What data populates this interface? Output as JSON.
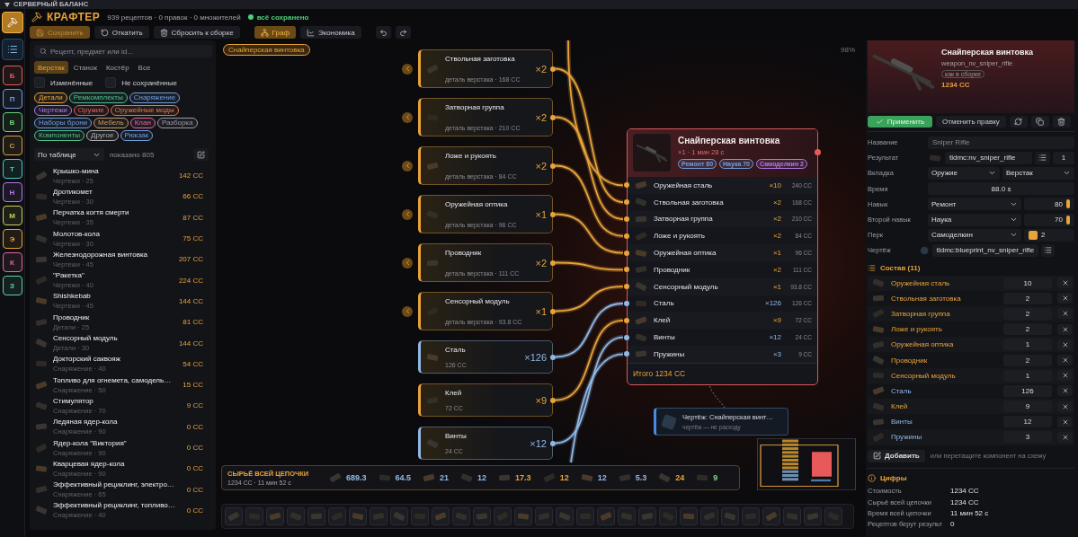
{
  "top_strip": {
    "title": "СЕРВЕРНЫЙ БАЛАНС"
  },
  "rail": {
    "tools": [
      {
        "kind": "crafter",
        "selected": true
      },
      {
        "kind": "list",
        "selected": false
      }
    ],
    "letters": [
      {
        "label": "Б",
        "color": "#e0605a"
      },
      {
        "label": "П",
        "color": "#6f9fe0"
      },
      {
        "label": "В",
        "color": "#6fcf7a"
      },
      {
        "label": "С",
        "color": "#d4a04a"
      },
      {
        "label": "Т",
        "color": "#4fc6c0"
      },
      {
        "label": "Н",
        "color": "#b07ae8"
      },
      {
        "label": "М",
        "color": "#c8d05a"
      },
      {
        "label": "Э",
        "color": "#e8a33a"
      },
      {
        "label": "К",
        "color": "#e06aa0"
      },
      {
        "label": "З",
        "color": "#5fd0a8"
      }
    ]
  },
  "header": {
    "title": "КРАФТЕР",
    "stats": "939 рецептов · 0 правок · 0 множителей",
    "status": "всё сохранено"
  },
  "toolbar": {
    "actions": [
      {
        "kind": "save",
        "label": "Сохранить"
      },
      {
        "kind": "revert",
        "label": "Откатить"
      },
      {
        "kind": "reset",
        "label": "Сбросить к сборке"
      }
    ],
    "views": [
      {
        "kind": "graph",
        "label": "Граф",
        "selected": true
      },
      {
        "kind": "economy",
        "label": "Экономика",
        "selected": false
      }
    ],
    "history": [
      {
        "kind": "undo"
      },
      {
        "kind": "redo"
      }
    ]
  },
  "sidebar": {
    "search": {
      "placeholder": "Рецепт, предмет или id..."
    },
    "tabs": [
      {
        "label": "Верстак",
        "selected": true
      },
      {
        "label": "Станок",
        "selected": false
      },
      {
        "label": "Костёр",
        "selected": false
      },
      {
        "label": "Все",
        "selected": false
      }
    ],
    "toggles": [
      {
        "label": "Изменённые",
        "checked": false
      },
      {
        "label": "Не сохранённые",
        "checked": false
      }
    ],
    "chips": [
      {
        "label": "Детали",
        "color": "#e8a33a"
      },
      {
        "label": "Ремкомплекты",
        "color": "#4fc08f"
      },
      {
        "label": "Снаряжение",
        "color": "#6f9fe0"
      },
      {
        "label": "Чертежи",
        "color": "#b07ae8"
      },
      {
        "label": "Оружие",
        "color": "#e0605a"
      },
      {
        "label": "Оружейные моды",
        "color": "#e07a4a"
      },
      {
        "label": "Наборы брони",
        "color": "#6f9fe0"
      },
      {
        "label": "Мебель",
        "color": "#c89a6a"
      },
      {
        "label": "Клан",
        "color": "#e06aa0"
      },
      {
        "label": "Разборка",
        "color": "#9a9aa0"
      },
      {
        "label": "Компоненты",
        "color": "#4fc08f"
      },
      {
        "label": "Другое",
        "color": "#b0b0b5"
      },
      {
        "label": "Рюкзак",
        "color": "#6f9fe0"
      }
    ],
    "sort": {
      "value": "По таблице"
    },
    "shown": "показано 805",
    "items": [
      {
        "name": "Крышко-мина",
        "meta": "Чертежи · 25",
        "cost": "142 CC"
      },
      {
        "name": "Дротикомет",
        "meta": "Чертежи · 30",
        "cost": "66 CC"
      },
      {
        "name": "Перчатка когтя смерти",
        "meta": "Чертежи · 35",
        "cost": "87 CC"
      },
      {
        "name": "Молотов-кола",
        "meta": "Чертежи · 30",
        "cost": "75 CC"
      },
      {
        "name": "Железнодорожная винтовка",
        "meta": "Чертежи · 45",
        "cost": "207 CC"
      },
      {
        "name": "\"Ракетка\"",
        "meta": "Чертежи · 40",
        "cost": "224 CC"
      },
      {
        "name": "Shishkebab",
        "meta": "Чертежи · 45",
        "cost": "144 CC"
      },
      {
        "name": "Проводник",
        "meta": "Детали · 25",
        "cost": "81 CC"
      },
      {
        "name": "Сенсорный модуль",
        "meta": "Детали · 30",
        "cost": "144 CC"
      },
      {
        "name": "Докторский саквояж",
        "meta": "Снаряжение · 40",
        "cost": "54 CC"
      },
      {
        "name": "Топливо для огнемета, самодель…",
        "meta": "Снаряжение · 50",
        "cost": "15 CC"
      },
      {
        "name": "Стимулятор",
        "meta": "Снаряжение · 70",
        "cost": "9 CC"
      },
      {
        "name": "Ледяная ядер-кола",
        "meta": "Снаряжение · 90",
        "cost": "0 CC"
      },
      {
        "name": "Ядер-кола \"Виктория\"",
        "meta": "Снаряжение · 90",
        "cost": "0 CC"
      },
      {
        "name": "Кварцевая ядер-кола",
        "meta": "Снаряжение · 90",
        "cost": "0 CC"
      },
      {
        "name": "Эффективный рециклинг, электро…",
        "meta": "Снаряжение · 65",
        "cost": "0 CC"
      },
      {
        "name": "Эффективный рециклинг, топливо…",
        "meta": "Снаряжение · 40",
        "cost": "0 CC"
      }
    ]
  },
  "canvas": {
    "breadcrumb": "Снайперская винтовка",
    "zoom": "98%",
    "sources": [
      {
        "kind": "part",
        "name": "Ствольная заготовка",
        "subtitle": "деталь верстака · 168 CC",
        "qty": "×2"
      },
      {
        "kind": "part",
        "name": "Затворная группа",
        "subtitle": "деталь верстака · 210 CC",
        "qty": "×2"
      },
      {
        "kind": "part",
        "name": "Ложе и рукоять",
        "subtitle": "деталь верстака · 84 CC",
        "qty": "×2"
      },
      {
        "kind": "part",
        "name": "Оружейная оптика",
        "subtitle": "деталь верстака · 96 CC",
        "qty": "×1"
      },
      {
        "kind": "part",
        "name": "Проводник",
        "subtitle": "деталь верстака · 111 CC",
        "qty": "×2"
      },
      {
        "kind": "part",
        "name": "Сенсорный модуль",
        "subtitle": "деталь верстака · 93.8 CC",
        "qty": "×1"
      },
      {
        "kind": "resource",
        "name": "Сталь",
        "subtitle": "126 CC",
        "qty": "×126"
      },
      {
        "kind": "crafted",
        "name": "Клей",
        "subtitle": "72 CC",
        "qty": "×9"
      },
      {
        "kind": "resource",
        "name": "Винты",
        "subtitle": "24 CC",
        "qty": "×12"
      }
    ],
    "target": {
      "title": "Снайперская винтовка",
      "meta": "×1 · 1 мин 28 с",
      "badges": [
        {
          "label": "Ремонт 80",
          "color": "#6f9fe0"
        },
        {
          "label": "Наука 70",
          "color": "#6f9fe0"
        },
        {
          "label": "Самоделкин 2",
          "color": "#b07ae8"
        }
      ],
      "rows": [
        {
          "kind": "part",
          "name": "Оружейная сталь",
          "qty": "×10",
          "cost": "240 CC"
        },
        {
          "kind": "part",
          "name": "Ствольная заготовка",
          "qty": "×2",
          "cost": "168 CC"
        },
        {
          "kind": "part",
          "name": "Затворная группа",
          "qty": "×2",
          "cost": "210 CC"
        },
        {
          "kind": "part",
          "name": "Ложе и рукоять",
          "qty": "×2",
          "cost": "84 CC"
        },
        {
          "kind": "part",
          "name": "Оружейная оптика",
          "qty": "×1",
          "cost": "96 CC"
        },
        {
          "kind": "part",
          "name": "Проводник",
          "qty": "×2",
          "cost": "111 CC"
        },
        {
          "kind": "part",
          "name": "Сенсорный модуль",
          "qty": "×1",
          "cost": "93.8 CC"
        },
        {
          "kind": "resource",
          "name": "Сталь",
          "qty": "×126",
          "cost": "126 CC"
        },
        {
          "kind": "crafted",
          "name": "Клей",
          "qty": "×9",
          "cost": "72 CC"
        },
        {
          "kind": "resource",
          "name": "Винты",
          "qty": "×12",
          "cost": "24 CC"
        },
        {
          "kind": "resource",
          "name": "Пружины",
          "qty": "×3",
          "cost": "9 CC"
        }
      ],
      "total": "Итого 1234 CC"
    },
    "blueprint": {
      "title": "Чертёж: Снайперская винт…",
      "subtitle": "чертёж — не расходу"
    },
    "summary": {
      "title": "СЫРЬЁ ВСЕЙ ЦЕПОЧКИ",
      "subtitle": "1234 CC · 11 мин 52 с",
      "items": [
        {
          "value": "689.3",
          "color": "#8fb8e6"
        },
        {
          "value": "64.5",
          "color": "#8fb8e6"
        },
        {
          "value": "21",
          "color": "#8fb8e6"
        },
        {
          "value": "12",
          "color": "#8fb8e6"
        },
        {
          "value": "17.3",
          "color": "#e8a33a"
        },
        {
          "value": "12",
          "color": "#e8a33a"
        },
        {
          "value": "12",
          "color": "#8fb8e6"
        },
        {
          "value": "5.3",
          "color": "#8fb8e6"
        },
        {
          "value": "24",
          "color": "#e8a33a"
        },
        {
          "value": "9",
          "color": "#7fd18b"
        }
      ]
    }
  },
  "inspector": {
    "preview": {
      "title": "Снайперская винтовка",
      "id": "weapon_nv_sniper_rifle",
      "badge": "как в сборке",
      "cost": "1234 CC"
    },
    "actions": [
      {
        "kind": "apply",
        "label": "Применить"
      },
      {
        "kind": "revert",
        "label": "Отменить правку"
      },
      {
        "kind": "refresh"
      },
      {
        "kind": "copy"
      },
      {
        "kind": "delete"
      }
    ],
    "fields": [
      {
        "kind": "text",
        "label": "Название",
        "placeholder": "Sniper Rifle"
      },
      {
        "kind": "result",
        "label": "Результат",
        "value": "tldmc:nv_sniper_rifle",
        "count": "1"
      },
      {
        "kind": "selects",
        "label": "Вкладка",
        "values": [
          "Оружие",
          "Верстак"
        ]
      },
      {
        "kind": "time",
        "label": "Время",
        "value": "88.0 s"
      },
      {
        "kind": "skill",
        "label": "Навык",
        "value": "Ремонт",
        "amount": "80"
      },
      {
        "kind": "skill",
        "label": "Второй навык",
        "value": "Наука",
        "amount": "70"
      },
      {
        "kind": "perk",
        "label": "Перк",
        "value": "Самоделкин",
        "amount": "2"
      },
      {
        "kind": "blueprint",
        "label": "Чертёж",
        "value": "tldmc:blueprint_nv_sniper_rifle"
      }
    ],
    "composition_title": "Состав (11)",
    "composition": [
      {
        "kind": "part",
        "name": "Оружейная сталь",
        "amount": "10"
      },
      {
        "kind": "part",
        "name": "Ствольная заготовка",
        "amount": "2"
      },
      {
        "kind": "part",
        "name": "Затворная группа",
        "amount": "2"
      },
      {
        "kind": "part",
        "name": "Ложе и рукоять",
        "amount": "2"
      },
      {
        "kind": "part",
        "name": "Оружейная оптика",
        "amount": "1"
      },
      {
        "kind": "part",
        "name": "Проводник",
        "amount": "2"
      },
      {
        "kind": "part",
        "name": "Сенсорный модуль",
        "amount": "1"
      },
      {
        "kind": "resource",
        "name": "Сталь",
        "amount": "126"
      },
      {
        "kind": "crafted",
        "name": "Клей",
        "amount": "9"
      },
      {
        "kind": "resource",
        "name": "Винты",
        "amount": "12"
      },
      {
        "kind": "resource",
        "name": "Пружины",
        "amount": "3"
      }
    ],
    "add_label": "Добавить",
    "add_hint": "или перетащите компонент на схему",
    "stats_title": "Цифры",
    "stats": [
      {
        "label": "Стоимость",
        "value": "1234 CC"
      },
      {
        "label": "Сырьё всей цепочки",
        "value": "1234 CC"
      },
      {
        "label": "Время всей цепочки",
        "value": "11 мин 52 с"
      },
      {
        "label": "Рецептов берут результ",
        "value": "0"
      }
    ]
  }
}
